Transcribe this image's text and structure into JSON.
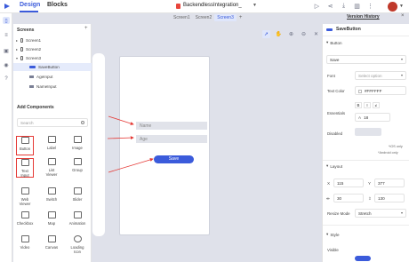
{
  "topbar": {
    "tab_design": "Design",
    "tab_blocks": "Blocks",
    "project_name": "BackendlessIntegration_",
    "version_history": "Version History",
    "close": "×"
  },
  "screen_tabs": {
    "tabs": [
      "Screen1",
      "Screen2",
      "Screen3"
    ],
    "active": "Screen3",
    "add": "+"
  },
  "left_panel": {
    "screens_title": "Screens",
    "add_label": "+",
    "tree": [
      {
        "label": "Screen1",
        "kind": "screen"
      },
      {
        "label": "Screen2",
        "kind": "screen"
      },
      {
        "label": "Screen3",
        "kind": "screen"
      },
      {
        "label": "SaveButton",
        "kind": "button",
        "selected": true
      },
      {
        "label": "AgeInput",
        "kind": "input"
      },
      {
        "label": "NameInput",
        "kind": "input"
      }
    ],
    "add_components_title": "Add Components",
    "search_placeholder": "Search",
    "components": [
      {
        "label": "Button",
        "highlight": true
      },
      {
        "label": "Label"
      },
      {
        "label": "Image"
      },
      {
        "label": "Text Input",
        "highlight": true
      },
      {
        "label": "List Viewer"
      },
      {
        "label": "Group"
      },
      {
        "label": "Web Viewer"
      },
      {
        "label": "Switch"
      },
      {
        "label": "Slider"
      },
      {
        "label": "Checkbox"
      },
      {
        "label": "Map"
      },
      {
        "label": "Animation"
      },
      {
        "label": "Video"
      },
      {
        "label": "Canvas"
      },
      {
        "label": "Loading Icon"
      }
    ]
  },
  "canvas": {
    "name_placeholder": "Name",
    "age_placeholder": "Age",
    "save_label": "Save"
  },
  "right_panel": {
    "component_name": "SaveButton",
    "button_section": "Button",
    "button_text": "Save",
    "font_label": "Font",
    "font_placeholder": "Select option",
    "text_color_label": "Text Color",
    "text_color_value": "#FFFFFF",
    "essentials_label": "Essentials",
    "bold": "B",
    "italic": "I",
    "strike": "≠",
    "font_size": "18",
    "disabled_label": "Disabled",
    "ios_note": "iOS only",
    "android_note": "Android only",
    "layout_section": "Layout",
    "x_label": "X",
    "x_value": "115",
    "y_label": "Y",
    "y_value": "377",
    "w_value": "30",
    "h_value": "130",
    "resize_label": "Resize Mode",
    "resize_value": "Stretch",
    "style_section": "Style",
    "visible_label": "Visible"
  },
  "colors": {
    "accent": "#3b5bdb",
    "highlight": "#e53935",
    "canvas_bg": "#dfe1ea"
  }
}
